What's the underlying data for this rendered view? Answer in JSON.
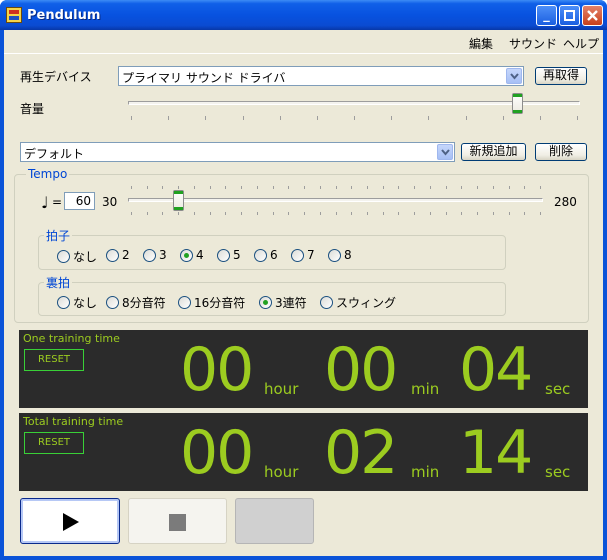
{
  "window": {
    "title": "Pendulum"
  },
  "menu": {
    "edit": "編集",
    "sound": "サウンド",
    "help": "ヘルプ"
  },
  "device": {
    "label": "再生デバイス",
    "value": "プライマリ サウンド ドライバ",
    "reacquire_label": "再取得"
  },
  "volume": {
    "label": "音量",
    "level": 0.86
  },
  "preset": {
    "value": "デフォルト",
    "add_label": "新規追加",
    "delete_label": "削除"
  },
  "tempo": {
    "group_title": "Tempo",
    "note_symbol": "♩",
    "equals": "=",
    "value": "60",
    "min_label": "30",
    "max_label": "280",
    "min": 30,
    "max": 280,
    "current": 60
  },
  "beats": {
    "group_title": "拍子",
    "options": [
      "なし",
      "2",
      "3",
      "4",
      "5",
      "6",
      "7",
      "8"
    ],
    "selected": "4"
  },
  "offbeat": {
    "group_title": "裏拍",
    "options": [
      "なし",
      "8分音符",
      "16分音符",
      "3連符",
      "スウィング"
    ],
    "selected": "3連符"
  },
  "one_training": {
    "title": "One training time",
    "reset_label": "RESET",
    "hours": "00",
    "hour_unit": "hour",
    "minutes": "00",
    "min_unit": "min",
    "seconds": "04",
    "sec_unit": "sec"
  },
  "total_training": {
    "title": "Total training time",
    "reset_label": "RESET",
    "hours": "00",
    "hour_unit": "hour",
    "minutes": "02",
    "min_unit": "min",
    "seconds": "14",
    "sec_unit": "sec"
  },
  "controls": {
    "play_icon": "play-icon",
    "stop_icon": "stop-icon"
  },
  "colors": {
    "accent": "#9ccc20",
    "panel": "#2b2b2b",
    "title_bar": "#0a53d8"
  }
}
